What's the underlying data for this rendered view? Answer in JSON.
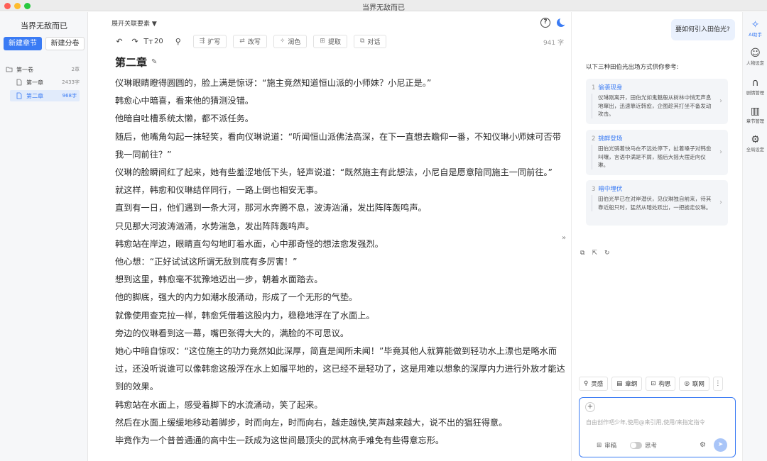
{
  "window": {
    "title": "当界无敌而已"
  },
  "sidebar": {
    "book_title": "当界无敌而已",
    "new_chapter": "新建章节",
    "new_volume": "新建分卷",
    "volume": {
      "label": "第一卷",
      "count": "2章"
    },
    "chapters": [
      {
        "label": "第一章",
        "count": "2433字"
      },
      {
        "label": "第二章",
        "count": "968字"
      }
    ]
  },
  "editor": {
    "expand_keywords": "展开关联要素 ▼",
    "font_size": "20",
    "tools": [
      "扩写",
      "改写",
      "润色",
      "提取",
      "对话"
    ],
    "word_count": "941 字",
    "chapter_title": "第二章",
    "paragraphs": [
      "仪琳眼睛瞪得圆圆的，脸上满是惊讶：“施主竟然知道恒山派的小师妹？小尼正是。”",
      "韩愈心中暗喜，看来他的猜测没错。",
      "他暗自吐槽系统太懒，都不派任务。",
      "随后，他嘴角勾起一抹轻笑，看向仪琳说道：“听闻恒山派佛法高深，在下一直想去瞻仰一番，不知仪琳小师妹可否带我一同前往？”",
      "仪琳的脸瞬间红了起来，她有些羞涩地低下头，轻声说道：“既然施主有此想法，小尼自是愿意陪同施主一同前往。”",
      "就这样，韩愈和仪琳结伴同行，一路上倒也相安无事。",
      "直到有一日，他们遇到一条大河，那河水奔腾不息，波涛汹涌，发出阵阵轰鸣声。",
      "只见那大河波涛汹涌，水势湍急，发出阵阵轰鸣声。",
      "韩愈站在岸边，眼睛直勾勾地盯着水面，心中那奇怪的想法愈发强烈。",
      "他心想：“正好试试这所谓无敌到底有多厉害！”",
      "想到这里，韩愈毫不犹豫地迈出一步，朝着水面踏去。",
      "他的脚底，强大的内力如潮水般涌动，形成了一个无形的气垫。",
      "就像使用查克拉一样，韩愈凭借着这股内力，稳稳地浮在了水面上。",
      "旁边的仪琳看到这一幕，嘴巴张得大大的，满脸的不可思议。",
      "她心中暗自惊叹：“这位施主的功力竟然如此深厚，简直是闻所未闻！”毕竟其他人就算能做到轻功水上漂也是略水而过，还没听说谁可以像韩愈这般浮在水上如履平地的，这已经不是轻功了，这是用难以想象的深厚内力进行外放才能达到的效果。",
      "韩愈站在水面上，感受着脚下的水流涌动，笑了起来。",
      "然后在水面上缓缓地移动着脚步，时而向左，时而向右，越走越快,笑声越来越大，说不出的猖狂得意。",
      "毕竟作为一个普普通通的高中生一跃成为这世间最顶尖的武林高手难免有些得意忘形。"
    ]
  },
  "ai": {
    "user_question": "要如何引入田伯光?",
    "intro": "以下三种田伯光出场方式供你参考:",
    "options": [
      {
        "num": "1",
        "title": "偷袭现身",
        "body": "仪琳刚离开，田伯光如鬼魅般从树林中悄无声息地窜出，迅速靠近韩愈，企图趁其打坐不备发动攻击。"
      },
      {
        "num": "2",
        "title": "挑衅登场",
        "body": "田伯光骑着快马在不远处停下，扯着嗓子对韩愈叫嚷，言语中满是不屑，随后大摇大摆走向仪琳。"
      },
      {
        "num": "3",
        "title": "暗中埋伏",
        "body": "田伯光早已在对岸潜伏，见仪琳独自前来，待其靠近船只时，猛然从暗处跃出，一把掳走仪琳。"
      }
    ],
    "quick_actions": [
      "灵感",
      "章纲",
      "构思",
      "联网"
    ],
    "input_placeholder": "自由创作吧少年,使用@来引用,使用/来指定指令",
    "review_label": "审稿",
    "think_label": "思考"
  },
  "rightnav": [
    {
      "label": "AI助手",
      "icon": "sparkle-icon"
    },
    {
      "label": "人物设定",
      "icon": "people-icon"
    },
    {
      "label": "剧情管理",
      "icon": "plot-icon"
    },
    {
      "label": "章节管理",
      "icon": "book-icon"
    },
    {
      "label": "全局设定",
      "icon": "gear-icon"
    }
  ],
  "colors": {
    "accent": "#3a7bf4",
    "sidebar_bg": "#f6f7f9",
    "selected_bg": "#e1ebfb"
  }
}
